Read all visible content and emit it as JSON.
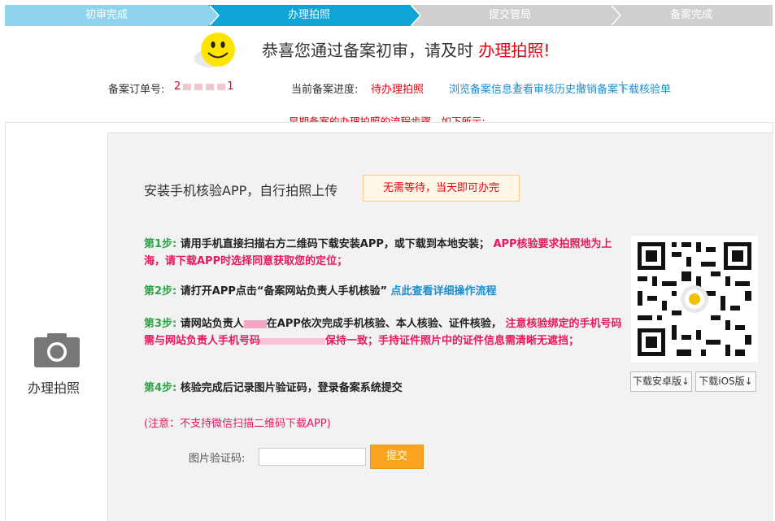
{
  "steps": [
    "初审完成",
    "办理拍照",
    "提交管局",
    "备案完成"
  ],
  "congrats": {
    "prefix": "恭喜您通过备案初审，请及时",
    "highlight": "办理拍照!"
  },
  "info": {
    "order_label": "备案订单号:",
    "order_num_start": "2",
    "order_num_end": "1",
    "progress_label": "当前备案进度:",
    "progress_value": "待办理拍照",
    "links": [
      "浏览备案信息",
      "查看审核历史",
      "撤销备案",
      "下载核验单"
    ]
  },
  "flow_note": "早期备案的办理拍照的流程步骤，如下所示:",
  "left": {
    "label": "办理拍照",
    "icon": "camera-icon"
  },
  "install": {
    "text": "安装手机核验APP，自行拍照上传",
    "badge": "无需等待，当天即可办完"
  },
  "step1": {
    "num": "第1步:",
    "text": "请用手机直接扫描右方二维码下载安装APP，或下载到本地安装；",
    "red": "APP核验要求拍照地为上海，请下载APP时选择同意获取您的定位；"
  },
  "step2": {
    "num": "第2步:",
    "text": "请打开APP点击“备案网站负责人手机核验”",
    "link": "点此查看详细操作流程"
  },
  "step3": {
    "num": "第3步:",
    "text_a": "请网站负责人",
    "text_b": "在APP依次完成手机核验、本人核验、证件核验，",
    "red_a": "注意核验绑定的手机号码需与网站负责人手机号码",
    "red_b": "保持一致；手持证件照片中的证件信息需清晰无遮挡；"
  },
  "step4": {
    "num": "第4步:",
    "text": "核验完成后记录图片验证码，登录备案系统提交"
  },
  "note": "(注意：不支持微信扫描二维码下载APP)",
  "captcha": {
    "label": "图片验证码:",
    "value": "",
    "placeholder": ""
  },
  "submit": "提交",
  "downloads": {
    "android": "下载安卓版↓",
    "ios": "下载iOS版↓"
  },
  "colors": {
    "accent": "#0fa4d6",
    "red": "#e60012",
    "green": "#2aa546",
    "link": "#1b8fd0",
    "button": "#f9a320"
  }
}
